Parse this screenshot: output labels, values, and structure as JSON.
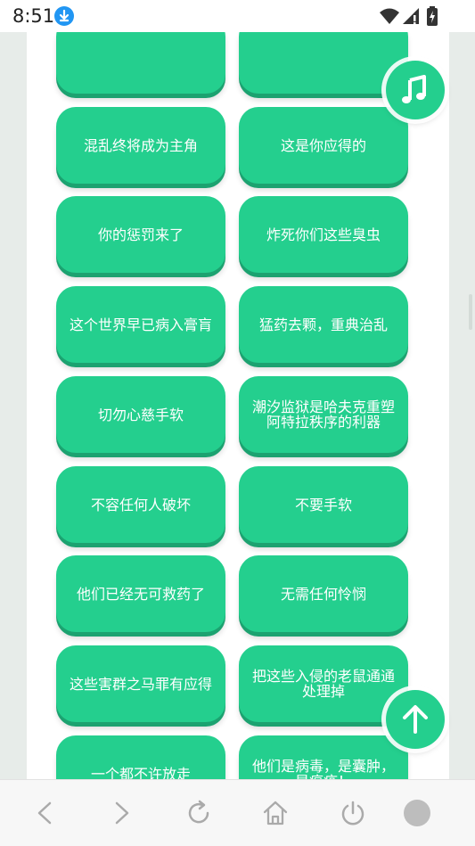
{
  "status_bar": {
    "time": "8:51"
  },
  "cards": [
    {
      "label": ""
    },
    {
      "label": ""
    },
    {
      "label": "混乱终将成为主角"
    },
    {
      "label": "这是你应得的"
    },
    {
      "label": "你的惩罚来了"
    },
    {
      "label": "炸死你们这些臭虫"
    },
    {
      "label": "这个世界早已病入膏肓"
    },
    {
      "label": "猛药去颗，重典治乱"
    },
    {
      "label": "切勿心慈手软"
    },
    {
      "label": "潮汐监狱是哈夫克重塑阿特拉秩序的利器"
    },
    {
      "label": "不容任何人破坏"
    },
    {
      "label": "不要手软"
    },
    {
      "label": "他们已经无可救药了"
    },
    {
      "label": "无需任何怜悯"
    },
    {
      "label": "这些害群之马罪有应得"
    },
    {
      "label": "把这些入侵的老鼠通通处理掉"
    },
    {
      "label": "一个都不许放走"
    },
    {
      "label": "他们是病毒，是囊肿，是瘟疫！"
    }
  ],
  "colors": {
    "card": "#24cf8e",
    "card_shadow": "#1ca270",
    "download_badge": "#2196f3"
  },
  "icons": {
    "music_fab": "music-note-icon",
    "top_fab": "arrow-up-icon",
    "nav": [
      "back-icon",
      "forward-icon",
      "refresh-icon",
      "home-icon",
      "power-icon",
      "circle-icon"
    ]
  }
}
